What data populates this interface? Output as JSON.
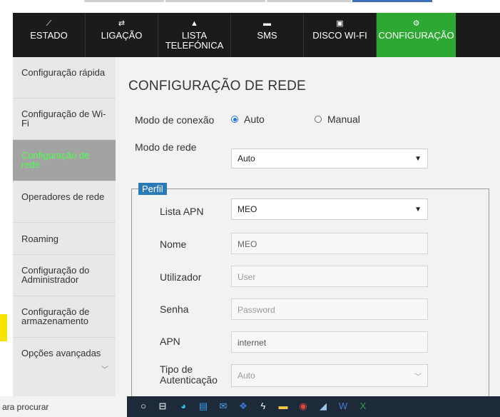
{
  "nav": [
    {
      "label": "ESTADO",
      "icon": "chart-icon",
      "glyph": "⟋"
    },
    {
      "label": "LIGAÇÃO",
      "icon": "swap-icon",
      "glyph": "⇄"
    },
    {
      "label": "LISTA\nTELEFÓNICA",
      "icon": "contacts-icon",
      "glyph": "▲"
    },
    {
      "label": "SMS",
      "icon": "message-icon",
      "glyph": "▬"
    },
    {
      "label": "DISCO WI-FI",
      "icon": "disk-icon",
      "glyph": "▣"
    },
    {
      "label": "CONFIGURAÇÃO",
      "icon": "settings-icon",
      "glyph": "⚙"
    }
  ],
  "sidebar": [
    {
      "label": "Configuração rápida"
    },
    {
      "label": "Configuração de Wi-Fi"
    },
    {
      "label": "Configuração de rede"
    },
    {
      "label": "Operadores de rede"
    },
    {
      "label": "Roaming"
    },
    {
      "label": "Configuração do Administrador"
    },
    {
      "label": "Configuração de armazenamento"
    },
    {
      "label": "Opções avançadas"
    }
  ],
  "page": {
    "title": "CONFIGURAÇÃO DE REDE",
    "connection_mode_label": "Modo de conexão",
    "radio_auto": "Auto",
    "radio_manual": "Manual",
    "network_mode_label": "Modo de rede",
    "network_mode_value": "Auto"
  },
  "profile": {
    "legend": "Perfil",
    "apn_list_label": "Lista APN",
    "apn_list_value": "MEO",
    "name_label": "Nome",
    "name_value": "MEO",
    "user_label": "Utilizador",
    "user_placeholder": "User",
    "password_label": "Senha",
    "password_placeholder": "Password",
    "apn_label": "APN",
    "apn_value": "internet",
    "auth_label": "Tipo de\nAutenticação",
    "auth_value": "Auto"
  },
  "taskbar": {
    "search_text": "ara procurar"
  },
  "colors": {
    "active_tab": "#2da832",
    "active_side_text": "#4cff4c",
    "legend_bg": "#2a7ab8"
  }
}
